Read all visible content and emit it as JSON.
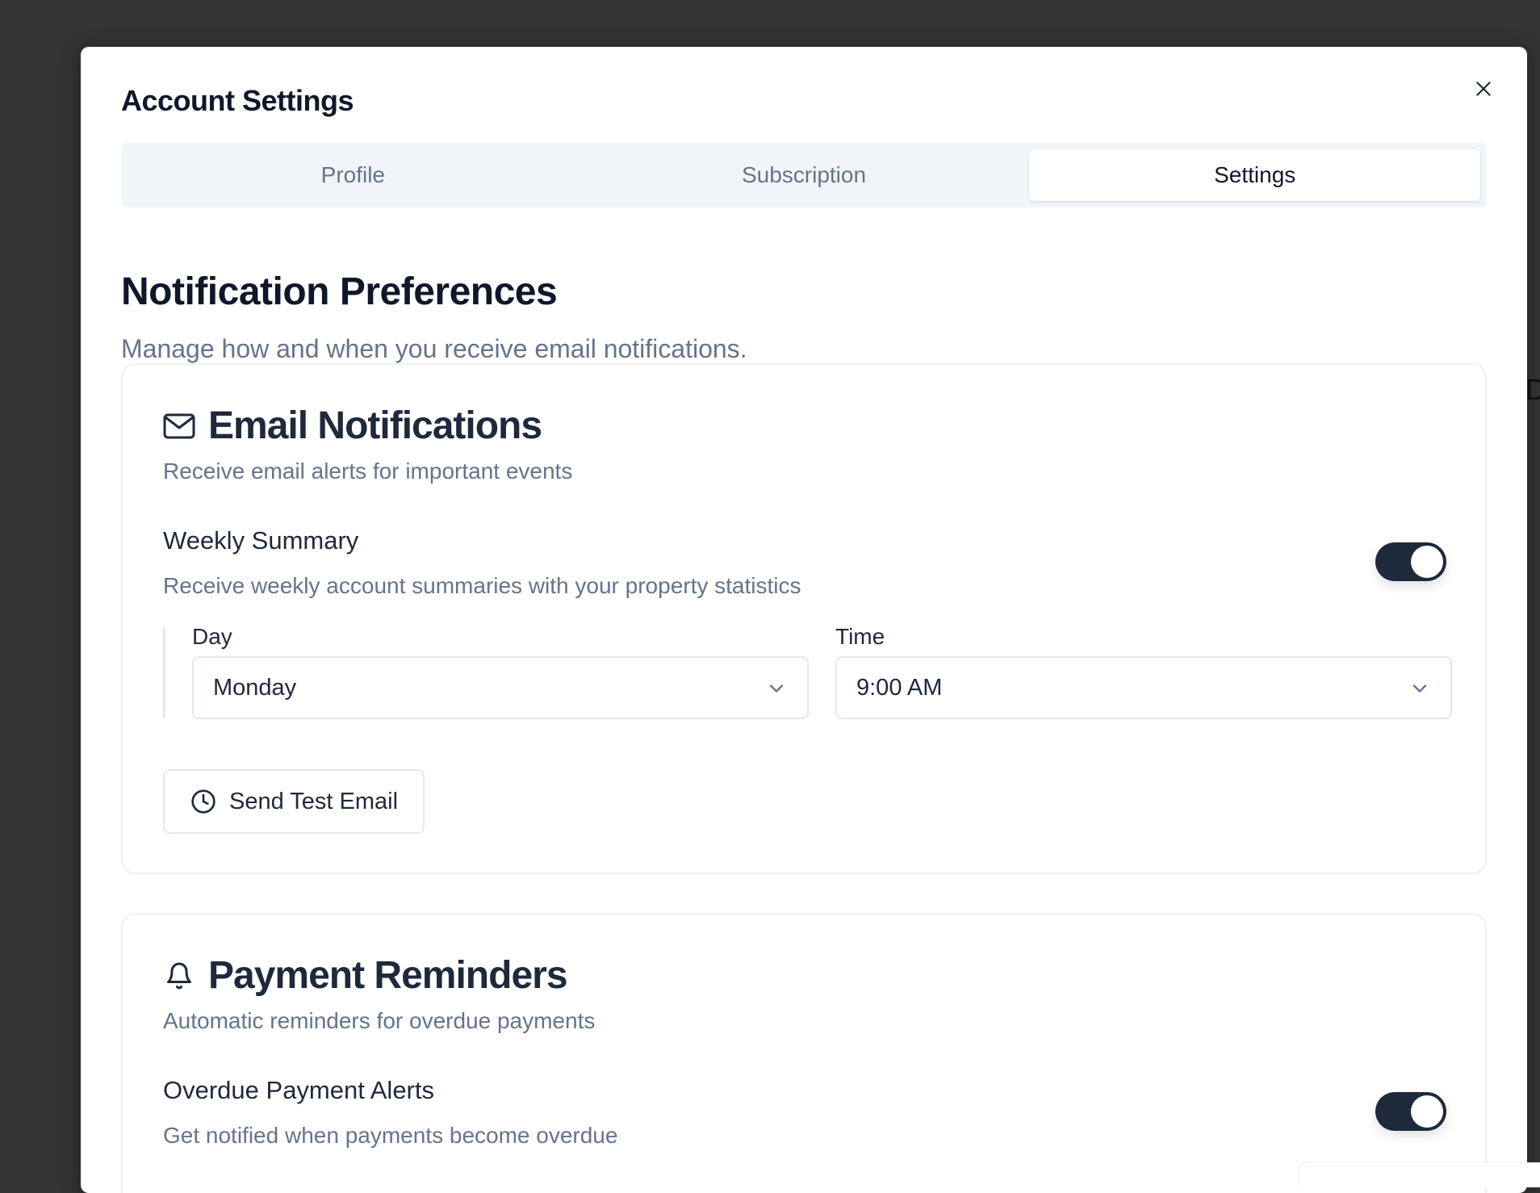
{
  "modal": {
    "title": "Account Settings",
    "close_icon": "close-icon"
  },
  "tabs": [
    {
      "label": "Profile",
      "active": false
    },
    {
      "label": "Subscription",
      "active": false
    },
    {
      "label": "Settings",
      "active": true
    }
  ],
  "section": {
    "title": "Notification Preferences",
    "description": "Manage how and when you receive email notifications."
  },
  "email_card": {
    "icon": "mail-icon",
    "title": "Email Notifications",
    "subtitle": "Receive email alerts for important events",
    "weekly_summary": {
      "title": "Weekly Summary",
      "description": "Receive weekly account summaries with your property statistics",
      "enabled": true
    },
    "day": {
      "label": "Day",
      "value": "Monday"
    },
    "time": {
      "label": "Time",
      "value": "9:00 AM"
    },
    "test_button": {
      "icon": "clock-icon",
      "label": "Send Test Email"
    }
  },
  "payment_card": {
    "icon": "bell-icon",
    "title": "Payment Reminders",
    "subtitle": "Automatic reminders for overdue payments",
    "overdue_alerts": {
      "title": "Overdue Payment Alerts",
      "description": "Get notified when payments become overdue",
      "enabled": true
    }
  },
  "colors": {
    "backdrop": "#333333",
    "toggle_on": "#1e293b",
    "muted_text": "#64748b",
    "heading_text": "#0f172a"
  }
}
